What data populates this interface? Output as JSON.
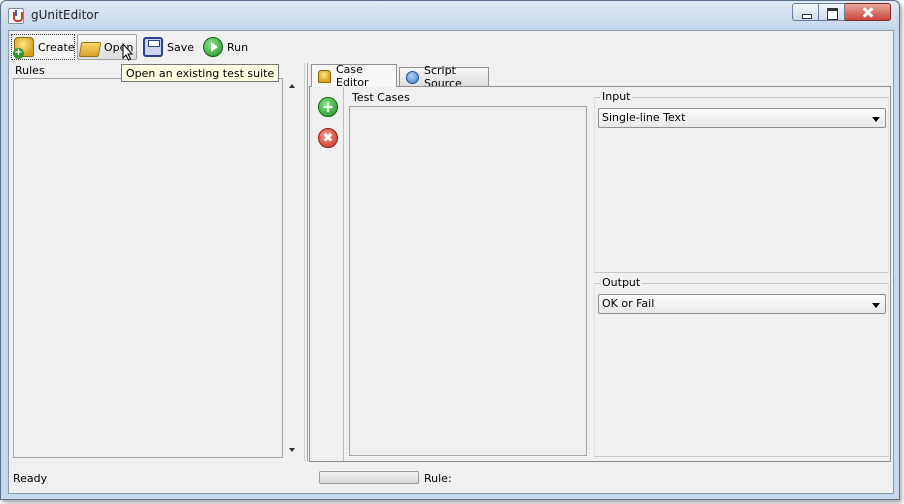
{
  "window": {
    "title": "gUnitEditor"
  },
  "toolbar": {
    "create_label": "Create",
    "open_label": "Open",
    "save_label": "Save",
    "run_label": "Run",
    "tooltip": "Open an existing test suite"
  },
  "rules_panel": {
    "label": "Rules"
  },
  "tabs": [
    {
      "label": "Case Editor",
      "icon": "case-editor-icon"
    },
    {
      "label": "Script Source",
      "icon": "script-source-icon"
    }
  ],
  "case_editor": {
    "test_cases_label": "Test Cases",
    "input": {
      "label": "Input",
      "selected": "Single-line Text"
    },
    "output": {
      "label": "Output",
      "selected": "OK or Fail"
    }
  },
  "status": {
    "text": "Ready",
    "rule_label": "Rule:",
    "progress": 0
  }
}
